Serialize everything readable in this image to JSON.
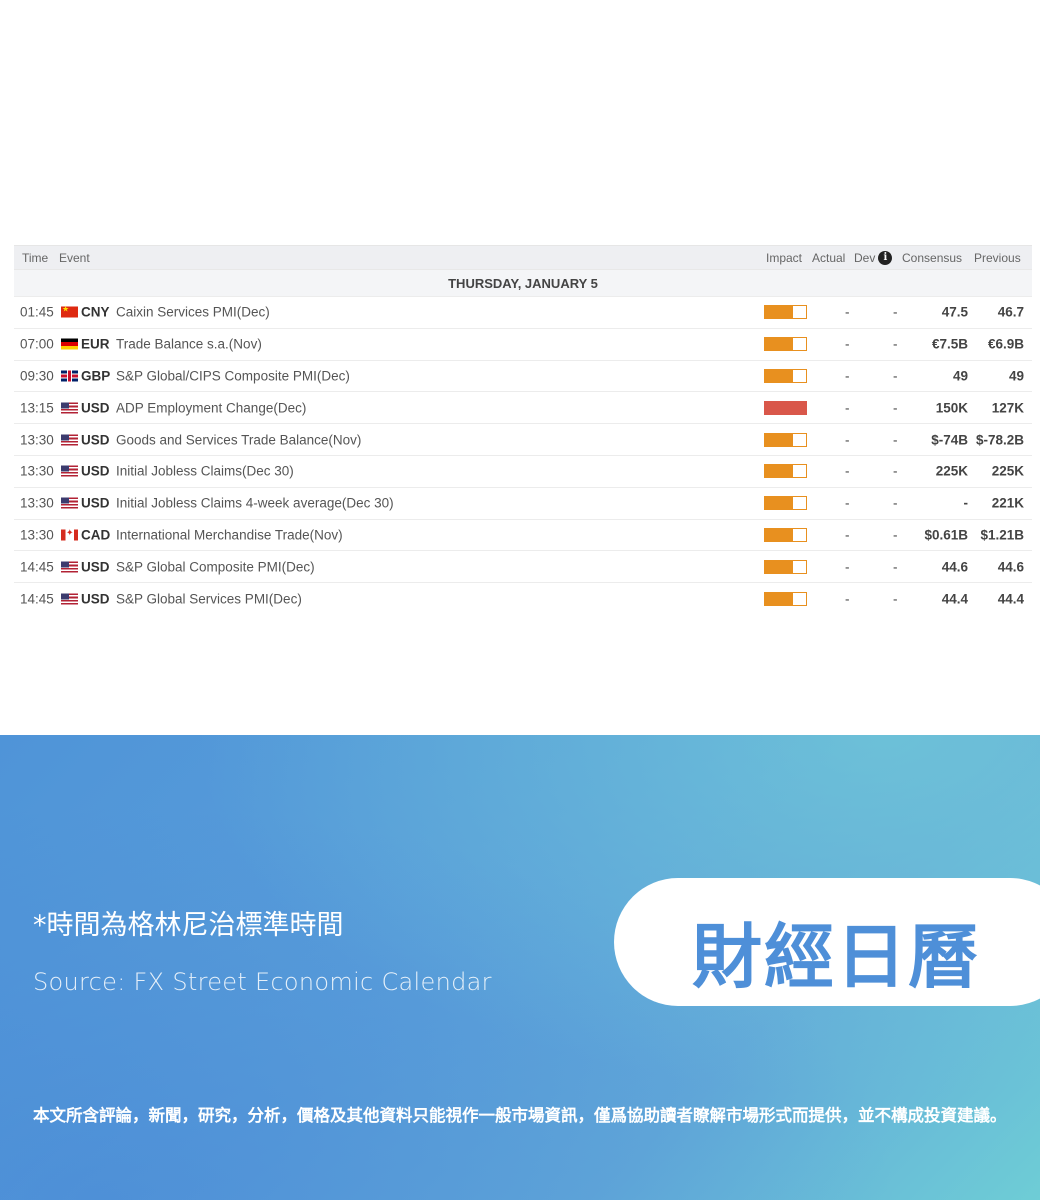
{
  "calendar": {
    "headers": {
      "time": "Time",
      "event": "Event",
      "impact": "Impact",
      "actual": "Actual",
      "dev": "Dev",
      "consensus": "Consensus",
      "previous": "Previous"
    },
    "day_label": "THURSDAY, JANUARY 5",
    "impact_colors": {
      "medium": "#e8901f",
      "high": "#d9574a"
    },
    "rows": [
      {
        "time": "01:45",
        "flag": "china-flag-icon",
        "currency": "CNY",
        "event": "Caixin Services PMI(Dec)",
        "impact": "medium",
        "actual": "-",
        "dev": "-",
        "consensus": "47.5",
        "previous": "46.7"
      },
      {
        "time": "07:00",
        "flag": "germany-flag-icon",
        "currency": "EUR",
        "event": "Trade Balance s.a.(Nov)",
        "impact": "medium",
        "actual": "-",
        "dev": "-",
        "consensus": "€7.5B",
        "previous": "€6.9B"
      },
      {
        "time": "09:30",
        "flag": "uk-flag-icon",
        "currency": "GBP",
        "event": "S&P Global/CIPS Composite PMI(Dec)",
        "impact": "medium",
        "actual": "-",
        "dev": "-",
        "consensus": "49",
        "previous": "49"
      },
      {
        "time": "13:15",
        "flag": "us-flag-icon",
        "currency": "USD",
        "event": "ADP Employment Change(Dec)",
        "impact": "high",
        "actual": "-",
        "dev": "-",
        "consensus": "150K",
        "previous": "127K"
      },
      {
        "time": "13:30",
        "flag": "us-flag-icon",
        "currency": "USD",
        "event": "Goods and Services Trade Balance(Nov)",
        "impact": "medium",
        "actual": "-",
        "dev": "-",
        "consensus": "$-74B",
        "previous": "$-78.2B"
      },
      {
        "time": "13:30",
        "flag": "us-flag-icon",
        "currency": "USD",
        "event": "Initial Jobless Claims(Dec 30)",
        "impact": "medium",
        "actual": "-",
        "dev": "-",
        "consensus": "225K",
        "previous": "225K"
      },
      {
        "time": "13:30",
        "flag": "us-flag-icon",
        "currency": "USD",
        "event": "Initial Jobless Claims 4-week average(Dec 30)",
        "impact": "medium",
        "actual": "-",
        "dev": "-",
        "consensus": "-",
        "previous": "221K"
      },
      {
        "time": "13:30",
        "flag": "canada-flag-icon",
        "currency": "CAD",
        "event": "International Merchandise Trade(Nov)",
        "impact": "medium",
        "actual": "-",
        "dev": "-",
        "consensus": "$0.61B",
        "previous": "$1.21B"
      },
      {
        "time": "14:45",
        "flag": "us-flag-icon",
        "currency": "USD",
        "event": "S&P Global Composite PMI(Dec)",
        "impact": "medium",
        "actual": "-",
        "dev": "-",
        "consensus": "44.6",
        "previous": "44.6"
      },
      {
        "time": "14:45",
        "flag": "us-flag-icon",
        "currency": "USD",
        "event": "S&P Global Services PMI(Dec)",
        "impact": "medium",
        "actual": "-",
        "dev": "-",
        "consensus": "44.4",
        "previous": "44.4"
      }
    ]
  },
  "banner": {
    "note": "*時間為格林尼治標準時間",
    "source": "Source: FX Street Economic Calendar",
    "title": "財經日曆",
    "disclaimer": "本文所含評論，新聞，研究，分析，價格及其他資料只能視作一般市場資訊，僅爲協助讀者瞭解市場形式而提供，並不構成投資建議。"
  }
}
